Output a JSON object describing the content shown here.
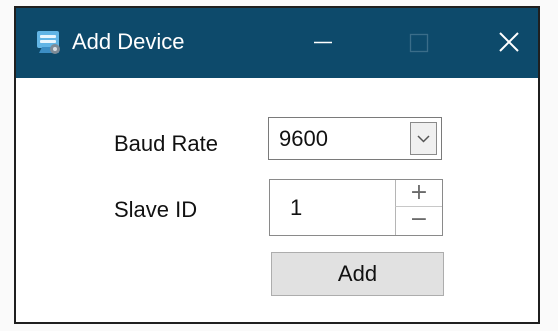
{
  "window": {
    "title": "Add Device",
    "icon": "app-icon",
    "controls": {
      "minimize": "minimize-icon",
      "maximize": "maximize-icon",
      "close": "close-icon"
    }
  },
  "form": {
    "baud_rate": {
      "label": "Baud Rate",
      "value": "9600"
    },
    "slave_id": {
      "label": "Slave ID",
      "value": "1",
      "up_symbol": "+",
      "down_symbol": "−"
    },
    "add_button": "Add"
  },
  "colors": {
    "titlebar": "#0d4a6b",
    "window_border": "#1f1f1f",
    "button_face": "#e1e1e1"
  }
}
